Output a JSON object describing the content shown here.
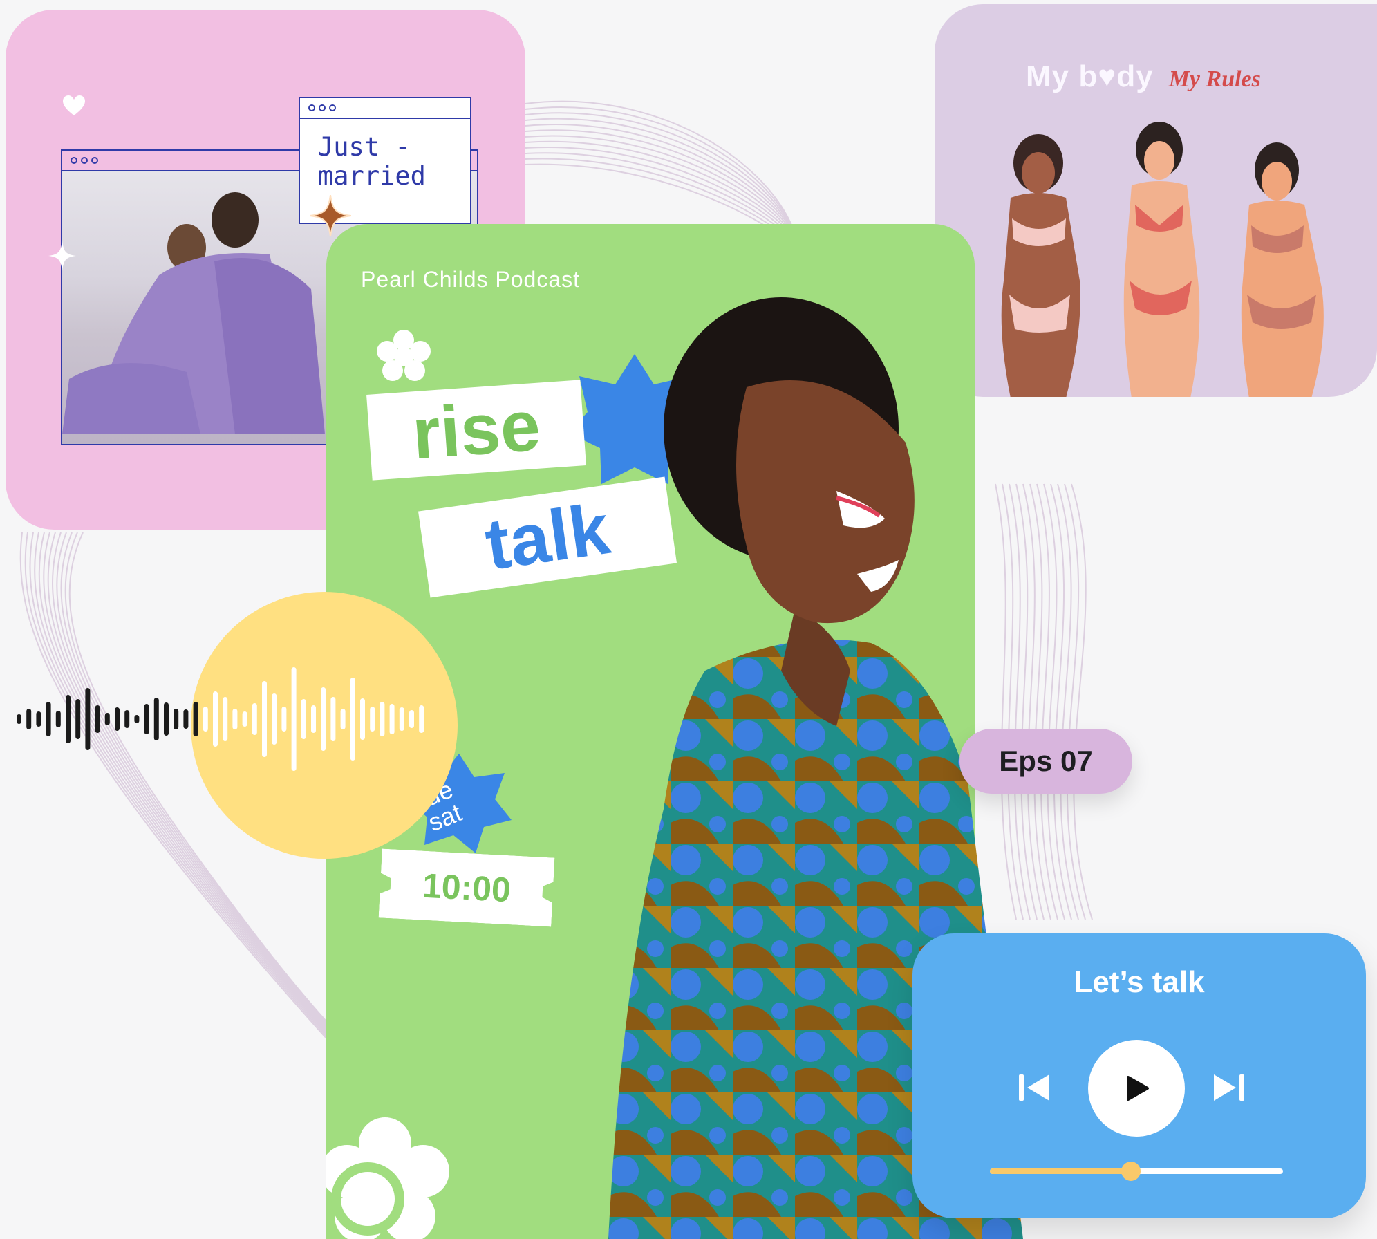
{
  "wedding_card": {
    "caption": "Just -\nmarried"
  },
  "body_card": {
    "title": "My b♥dy",
    "subtitle": "My Rules"
  },
  "podcast_card": {
    "show_name": "Pearl Childs Podcast",
    "title_line1": "rise",
    "title_amp": "&",
    "title_line2": "talk",
    "days": "tue\nsat",
    "time": "10:00"
  },
  "episode_badge": "Eps 07",
  "player": {
    "title": "Let’s talk",
    "progress": 0.48
  },
  "colors": {
    "pink": "#f2bfe2",
    "lilac": "#dccde4",
    "green": "#a1dd7f",
    "blue": "#5aaef0",
    "yellow": "#ffe081",
    "badge": "#d8b5dd"
  }
}
